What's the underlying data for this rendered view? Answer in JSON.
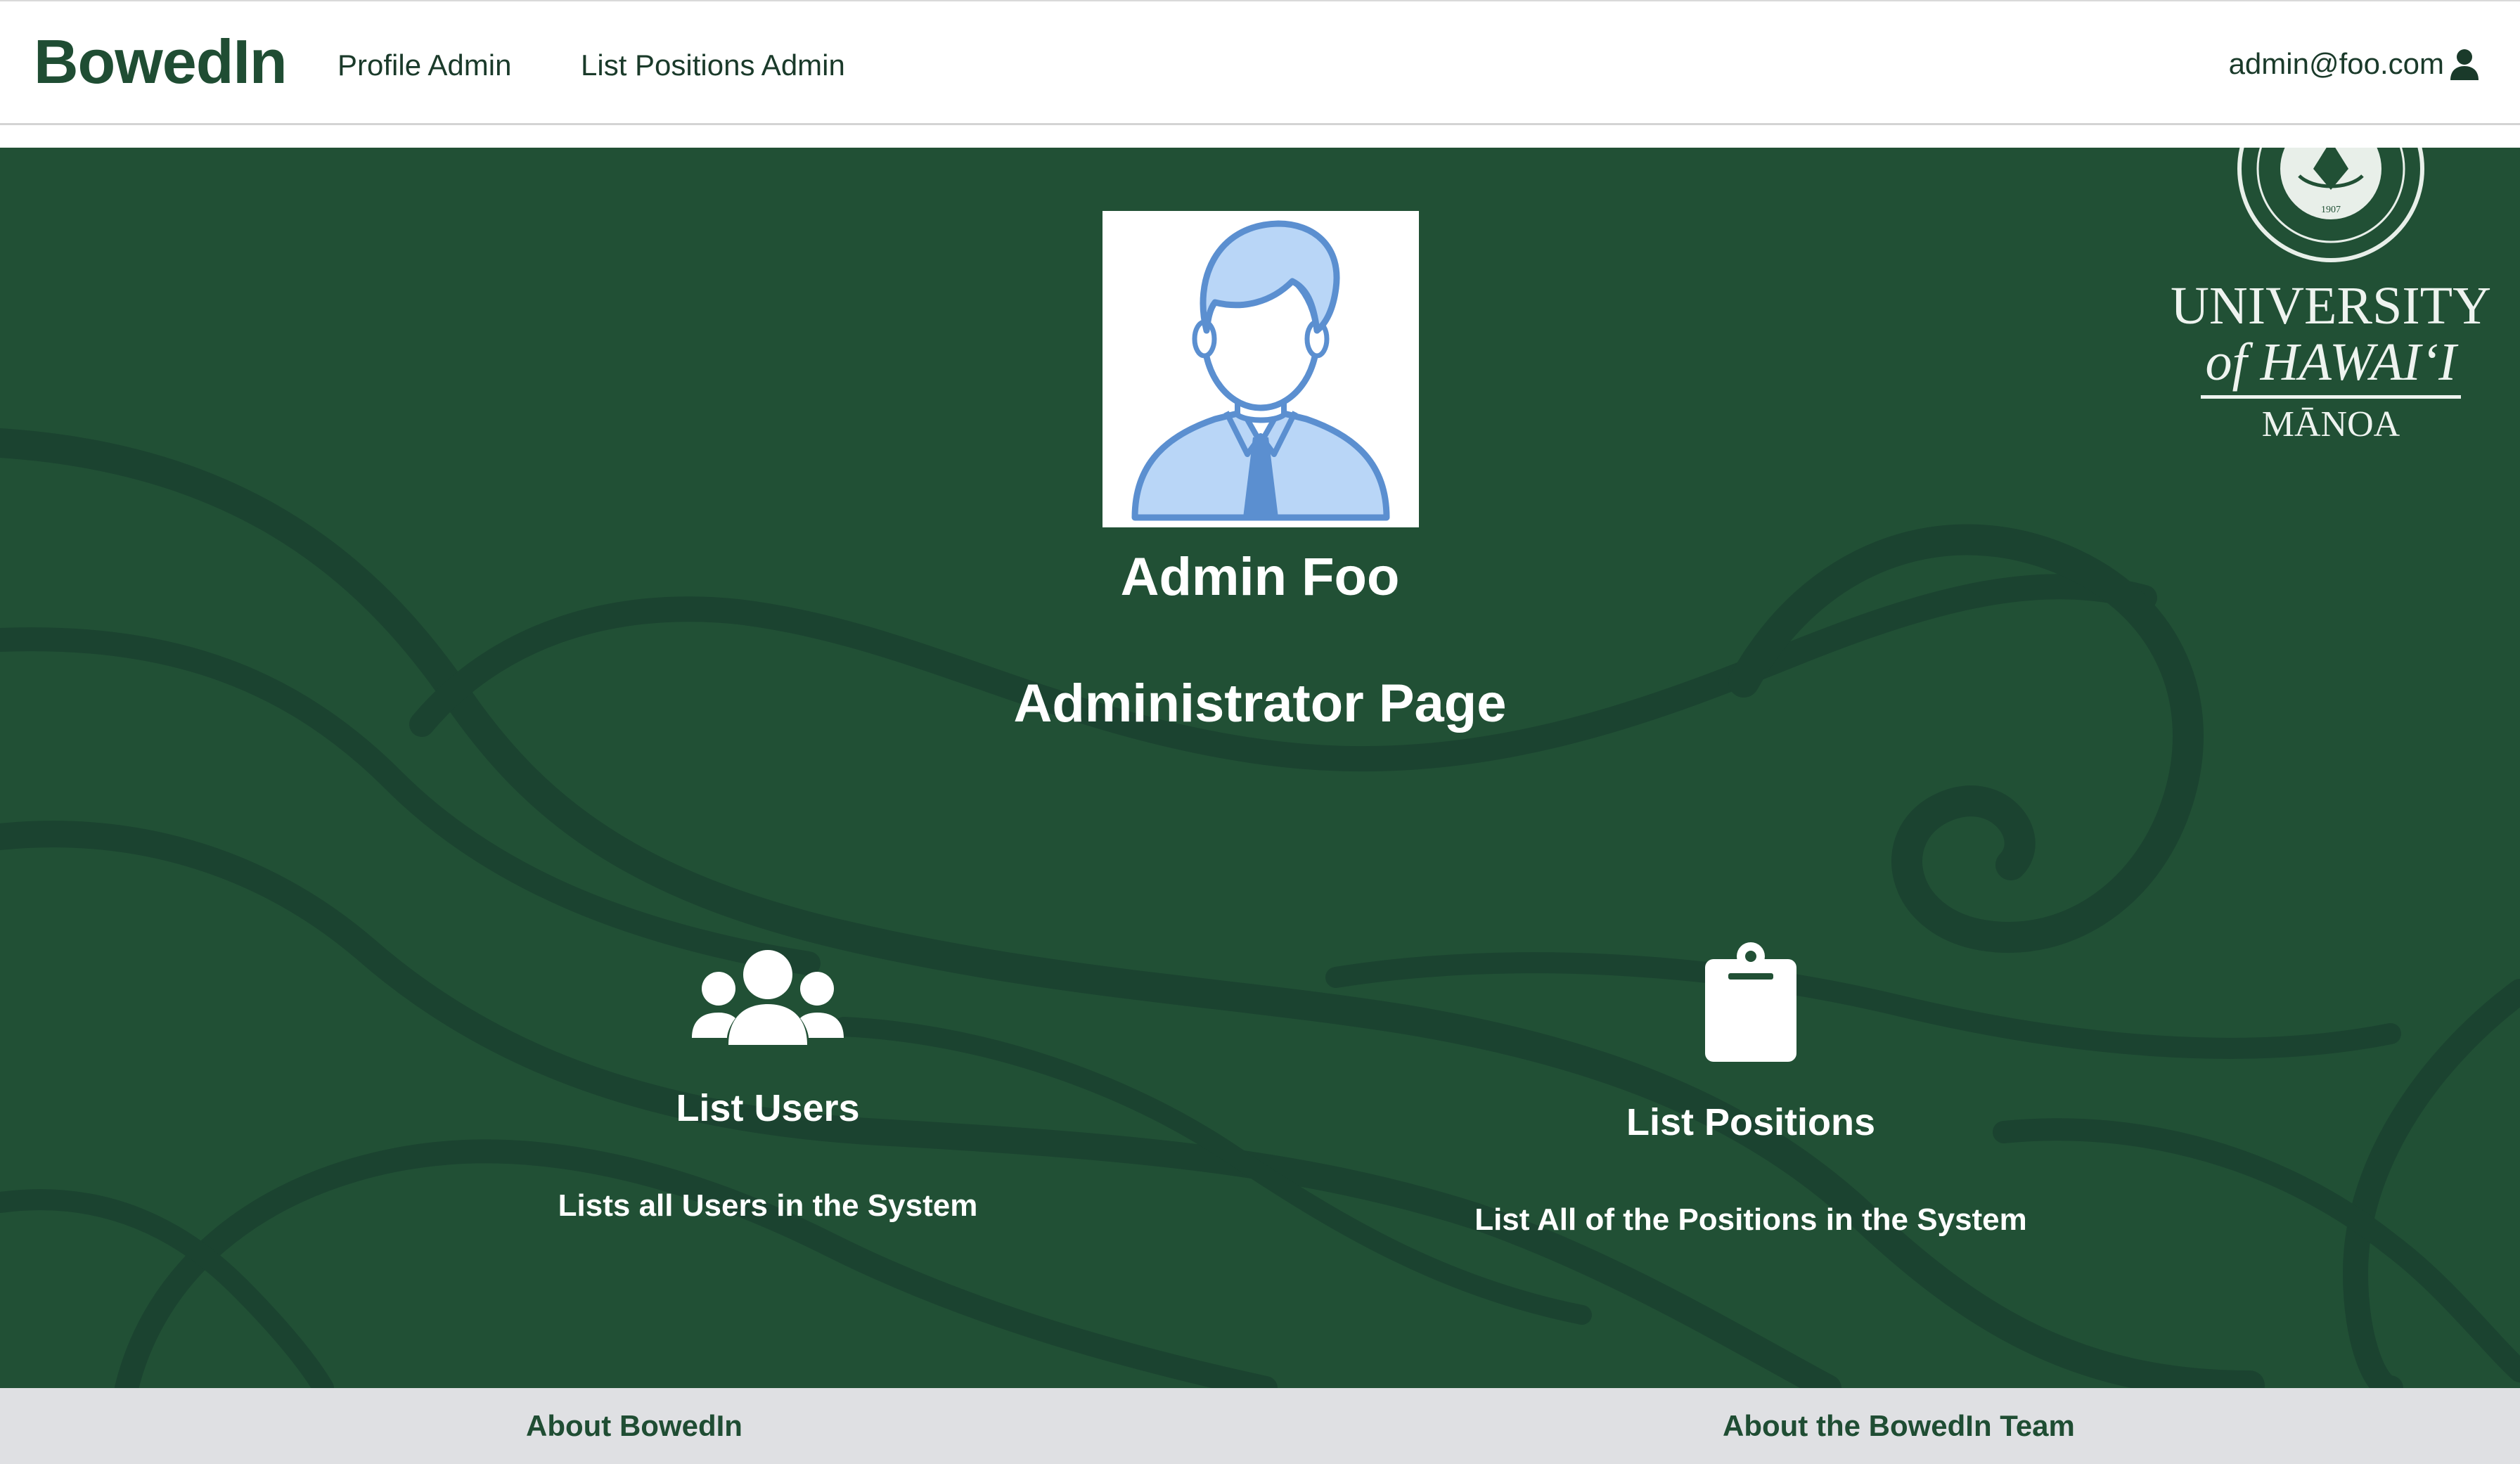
{
  "navbar": {
    "brand": "BowedIn",
    "links": [
      {
        "label": "Profile Admin"
      },
      {
        "label": "List Positions Admin"
      }
    ],
    "user_email": "admin@foo.com",
    "user_icon": "user-icon"
  },
  "hero": {
    "logo": {
      "line1": "UNIVERSITY",
      "line2": "of HAWAI‘I",
      "line3": "MĀNOA",
      "seal_icon": "uh-seal-icon"
    },
    "avatar_icon": "user-avatar-icon",
    "admin_name": "Admin Foo",
    "page_title": "Administrator Page",
    "cards": [
      {
        "icon": "users-icon",
        "title": "List Users",
        "description": "Lists all Users in the System"
      },
      {
        "icon": "clipboard-icon",
        "title": "List Positions",
        "description": "List All of the Positions in the System"
      }
    ]
  },
  "footer": {
    "links": [
      {
        "label": "About BowedIn"
      },
      {
        "label": "About the BowedIn Team"
      }
    ]
  },
  "colors": {
    "brand_green": "#215035",
    "brand_text": "#1f4d33",
    "footer_bg": "#dfe0e3",
    "avatar_blue": "#5b8fd0",
    "avatar_light_blue": "#b9d6f7"
  }
}
